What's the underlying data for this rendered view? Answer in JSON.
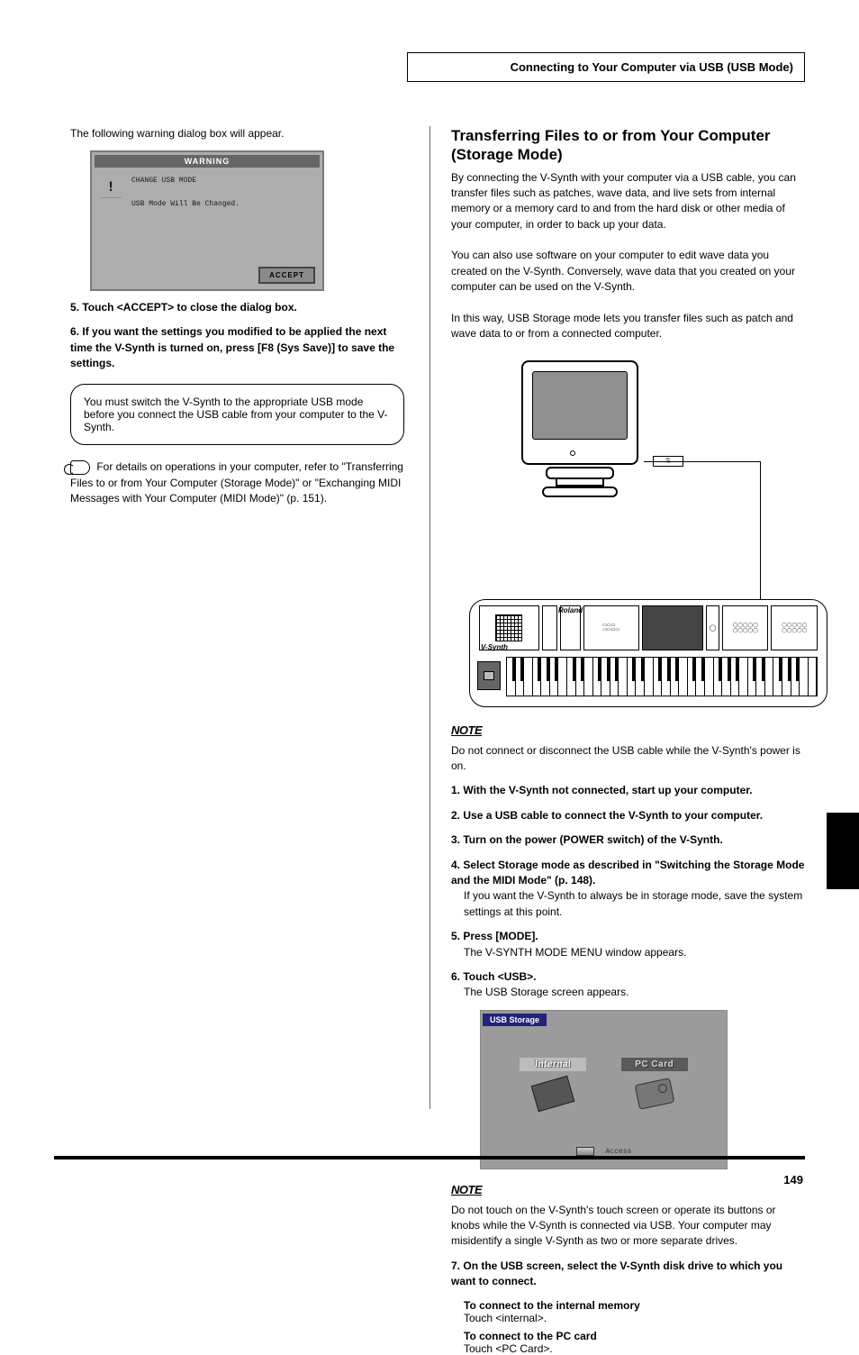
{
  "page": {
    "header_title": "Connecting to Your Computer via USB (USB Mode)",
    "page_number": "149"
  },
  "left": {
    "body1": "The following warning dialog box will appear.",
    "shot_warn": {
      "title": "WARNING",
      "line1": "CHANGE USB MODE",
      "line2": "USB Mode Will Be Changed.",
      "button": "ACCEPT"
    },
    "step5": "Touch <ACCEPT> to close the dialog box.",
    "step6_lead": "If you want the settings you modified to be applied the next time the V-Synth is turned on, press [F8 (Sys Save)] to save the settings.",
    "step6_body": "",
    "tip": "You must switch the V-Synth to the appropriate USB mode before you connect the USB cable from your computer to the V-Synth.",
    "hint_lead": "For details on operations in your computer, refer to \"Transferring Files to or from Your Computer (Storage Mode)\" or \"Exchanging MIDI Messages with Your Computer (MIDI Mode)\" (p. 151).",
    "step5_prefix": "5.",
    "step6_prefix": "6."
  },
  "right": {
    "h2": "Transferring Files to or from Your Computer (Storage Mode)",
    "intro": "By connecting the V-Synth with your computer via a USB cable, you can transfer files such as patches, wave data, and live sets from internal memory or a memory card to and from the hard disk or other media of your computer, in order to back up your data.\n\nYou can also use software on your computer to edit wave data you created on the V-Synth. Conversely, wave data that you created on your computer can be used on the V-Synth.\n\nIn this way, USB Storage mode lets you transfer files such as patch and wave data to or from a connected computer.",
    "note1": "Do not connect or disconnect the USB cable while the V-Synth's power is on.",
    "step1_prefix": "1.",
    "step1": "With the V-Synth not connected, start up your computer.",
    "step2_prefix": "2.",
    "step2": "Use a USB cable to connect the V-Synth to your computer.",
    "step3_prefix": "3.",
    "step3": "Turn on the power (POWER switch) of the V-Synth.",
    "step4_prefix": "4.",
    "step4": "Select Storage mode as described in \"Switching the Storage Mode and the MIDI Mode\" (p. 148).",
    "step4_note": "If you want the V-Synth to always be in storage mode, save the system settings at this point.",
    "step5_prefix": "5.",
    "step5": "Press [MODE].",
    "step5_body": "The V-SYNTH MODE MENU window appears.",
    "step6_prefix": "6.",
    "step6": "Touch <USB>.",
    "step6_body": "The USB Storage screen appears.",
    "shot_usb": {
      "tab": "USB Storage",
      "internal": "Internal",
      "pc_card": "PC Card",
      "access": "Access"
    },
    "note2": "Do not touch on the V-Synth's touch screen or operate its buttons or knobs while the V-Synth is connected via USB. Your computer may misidentify a single V-Synth as two or more separate drives.",
    "step7_prefix": "7.",
    "step7": "On the USB screen, select the V-Synth disk drive to which you want to connect.",
    "step7_int": "To connect to the internal memory",
    "step7_int2": "Touch <internal>.",
    "step7_pc": "To connect to the PC card",
    "step7_pc2": "Touch <PC Card>.",
    "note_label_1": "NOTE",
    "note_label_2": "NOTE"
  }
}
